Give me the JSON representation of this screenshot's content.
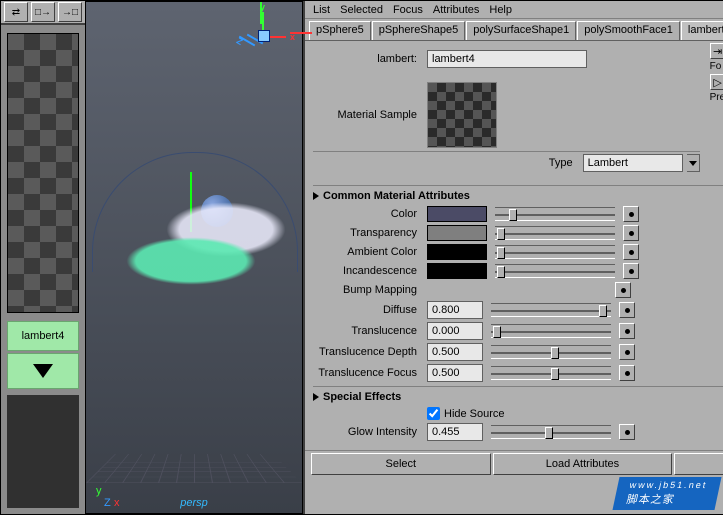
{
  "toolbar_icons": [
    "swap-icon",
    "export-icon",
    "import-icon"
  ],
  "material_name": "lambert4",
  "viewport": {
    "camera": "persp",
    "axis": {
      "x": "x",
      "y": "y",
      "z": "Z"
    }
  },
  "menu": [
    "List",
    "Selected",
    "Focus",
    "Attributes",
    "Help"
  ],
  "tabs": [
    "pSphere5",
    "pSphereShape5",
    "polySurfaceShape1",
    "polySmoothFace1",
    "lambert"
  ],
  "name_field": {
    "label": "lambert:",
    "value": "lambert4"
  },
  "right_buttons": {
    "focus": "Fo",
    "presets": "Pre"
  },
  "material_sample_label": "Material Sample",
  "type_row": {
    "label": "Type",
    "value": "Lambert"
  },
  "sections": {
    "common": "Common Material Attributes",
    "special": "Special Effects"
  },
  "attrs": [
    {
      "label": "Color",
      "swatch": "#4b4b66",
      "pos": 12
    },
    {
      "label": "Transparency",
      "swatch": "#7f7f7f",
      "pos": 2
    },
    {
      "label": "Ambient Color",
      "swatch": "#000000",
      "pos": 2
    },
    {
      "label": "Incandescence",
      "swatch": "#000000",
      "pos": 2
    },
    {
      "label": "Bump Mapping",
      "swatch": null,
      "pos": null
    },
    {
      "label": "Diffuse",
      "value": "0.800",
      "pos": 90
    },
    {
      "label": "Translucence",
      "value": "0.000",
      "pos": 2
    },
    {
      "label": "Translucence Depth",
      "value": "0.500",
      "pos": 50
    },
    {
      "label": "Translucence Focus",
      "value": "0.500",
      "pos": 50
    }
  ],
  "special": {
    "hide_label": "Hide Source",
    "glow_label": "Glow Intensity",
    "glow_value": "0.455"
  },
  "footer": {
    "select": "Select",
    "load": "Load Attributes"
  },
  "watermark": {
    "main": "脚本之家",
    "sub": "www.jb51.net"
  }
}
